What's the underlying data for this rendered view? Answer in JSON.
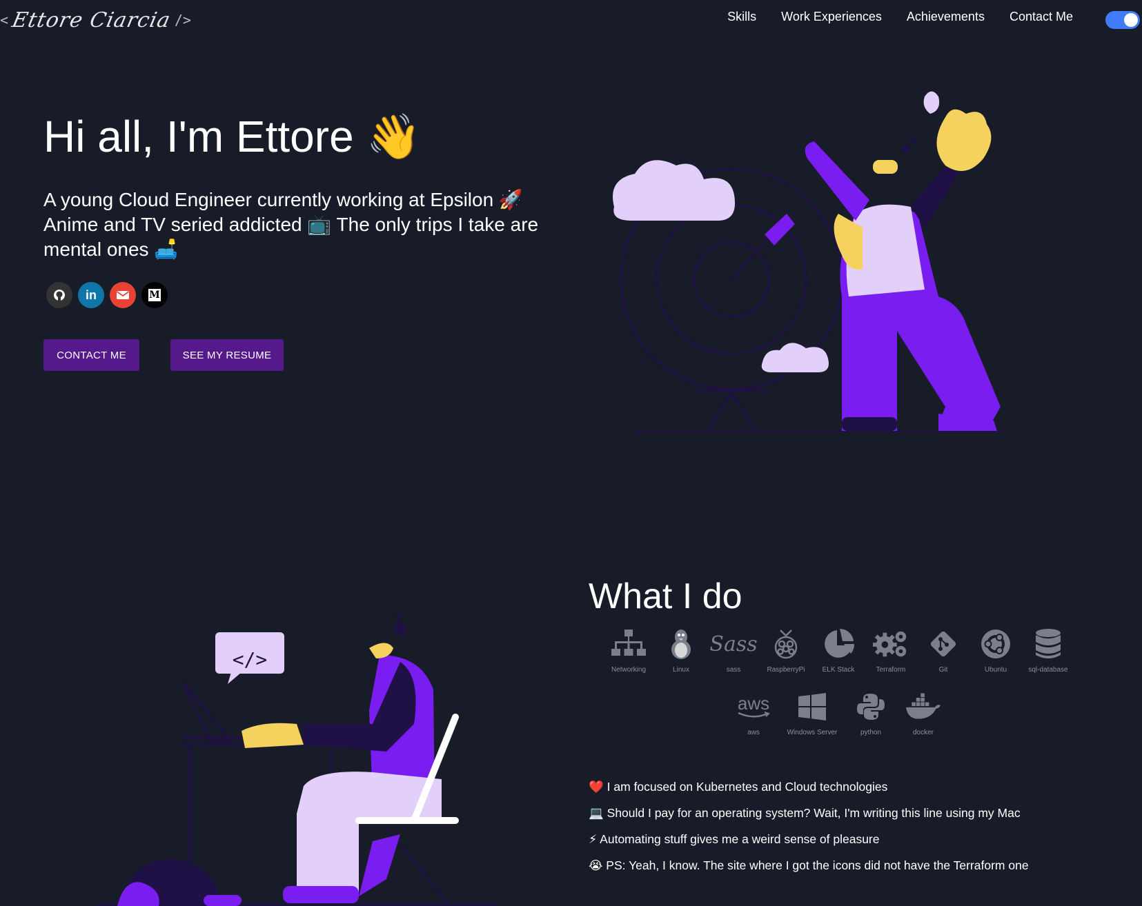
{
  "header": {
    "logo_open": "<",
    "logo_name": "Ettore Ciarcia",
    "logo_close": "/>",
    "nav": [
      "Skills",
      "Work Experiences",
      "Achievements",
      "Contact Me"
    ]
  },
  "hero": {
    "title": "Hi all, I'm Ettore 👋",
    "subtitle": "A young Cloud Engineer currently working at Epsilon 🚀 Anime and TV seried addicted 📺 The only trips I take are mental ones 🛋️",
    "socials": [
      {
        "name": "github-icon",
        "color": "#333333"
      },
      {
        "name": "linkedin-icon",
        "color": "#0e76a8"
      },
      {
        "name": "mail-icon",
        "color": "#ea4335"
      },
      {
        "name": "medium-icon",
        "color": "#000000"
      }
    ],
    "contact_button": "CONTACT ME",
    "resume_button": "SEE MY RESUME"
  },
  "what_i_do": {
    "title": "What I do",
    "skills": [
      {
        "label": "Networking",
        "icon": "network-icon"
      },
      {
        "label": "Linux",
        "icon": "linux-icon"
      },
      {
        "label": "sass",
        "icon": "sass-icon"
      },
      {
        "label": "RaspberryPi",
        "icon": "raspberry-pi-icon"
      },
      {
        "label": "ELK Stack",
        "icon": "elk-pie-icon"
      },
      {
        "label": "Terraform",
        "icon": "gears-icon"
      },
      {
        "label": "Git",
        "icon": "git-icon"
      },
      {
        "label": "Ubuntu",
        "icon": "ubuntu-icon"
      },
      {
        "label": "sql-database",
        "icon": "database-icon"
      },
      {
        "label": "aws",
        "icon": "aws-icon"
      },
      {
        "label": "Windows Server",
        "icon": "windows-icon"
      },
      {
        "label": "python",
        "icon": "python-icon"
      },
      {
        "label": "docker",
        "icon": "docker-icon"
      }
    ],
    "points": [
      "❤️ I am focused on Kubernetes and Cloud technologies",
      "💻 Should I pay for an operating system? Wait, I'm writing this line using my Mac",
      "⚡ Automating stuff gives me a weird sense of pleasure",
      "😭 PS: Yeah, I know. The site where I got the icons did not have the Terraform one"
    ],
    "code_bubble": "</>"
  },
  "colors": {
    "background": "#171c28",
    "button": "#55198b",
    "accent_purple": "#7a1df0",
    "lavender": "#e2cffa",
    "skin": "#f5d25e",
    "toggle": "#3f7cf5"
  }
}
